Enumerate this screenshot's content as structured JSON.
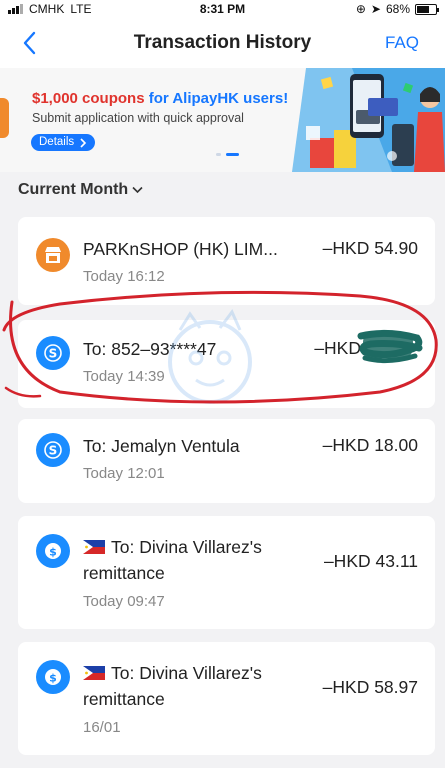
{
  "status_bar": {
    "carrier": "CMHK",
    "network": "LTE",
    "time": "8:31 PM",
    "battery": "68%",
    "battery_level": 0.68
  },
  "navbar": {
    "title": "Transaction History",
    "faq_label": "FAQ",
    "back_icon": "chevron-left-icon"
  },
  "banner": {
    "title_amount": "$1,000 coupons",
    "title_for": " for ",
    "title_brand": "AlipayHK users!",
    "subtitle": "Submit application with quick approval",
    "details_label": "Details"
  },
  "section": {
    "title": "Current Month"
  },
  "transactions": [
    {
      "name": "PARKnSHOP (HK) LIM...",
      "amount": "–HKD 54.90",
      "time": "Today 16:12",
      "icon": "shop-icon"
    },
    {
      "name": "To: 852–93****47",
      "amount": "–HKD",
      "time": "Today 14:39",
      "icon": "transfer-icon"
    },
    {
      "name": "To: Jemalyn Ventula",
      "amount": "–HKD 18.00",
      "time": "Today 12:01",
      "icon": "transfer-icon"
    },
    {
      "name_line1": "To: Divina Villarez's",
      "name_line2": "remittance",
      "amount": "–HKD 43.11",
      "time": "Today 09:47",
      "icon": "remittance-icon"
    },
    {
      "name_line1": "To: Divina Villarez's",
      "name_line2": "remittance",
      "amount": "–HKD 58.97",
      "time": "16/01",
      "icon": "remittance-icon"
    }
  ],
  "colors": {
    "accent": "#1677ff",
    "banner_red": "#e0332d",
    "shop_orange": "#f08a2c",
    "annotation_red": "#d3232c"
  }
}
